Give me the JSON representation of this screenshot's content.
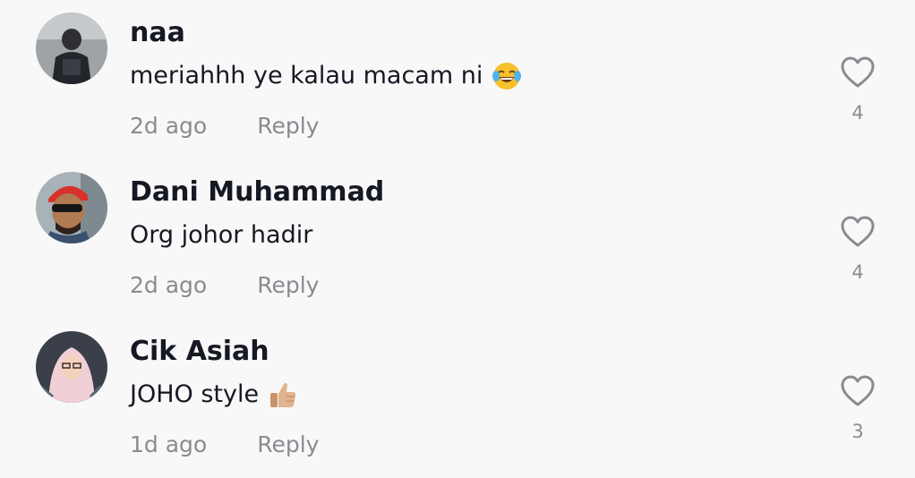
{
  "comments": [
    {
      "username": "naa",
      "text": "meriahhh ye kalau macam ni",
      "emoji": "face-with-tears-of-joy",
      "time": "2d ago",
      "reply_label": "Reply",
      "likes": "4",
      "heart_icon": "heart-outline-icon"
    },
    {
      "username": "Dani Muhammad",
      "text": "Org johor hadir",
      "emoji": "",
      "time": "2d ago",
      "reply_label": "Reply",
      "likes": "4",
      "heart_icon": "heart-outline-icon"
    },
    {
      "username": "Cik Asiah",
      "text": "JOHO style",
      "emoji": "thumbs-up",
      "time": "1d ago",
      "reply_label": "Reply",
      "likes": "3",
      "heart_icon": "heart-outline-icon"
    }
  ],
  "colors": {
    "background": "#f8f8f8",
    "username": "#161823",
    "meta": "#8a8b91",
    "heart_stroke": "#8a8b91"
  }
}
